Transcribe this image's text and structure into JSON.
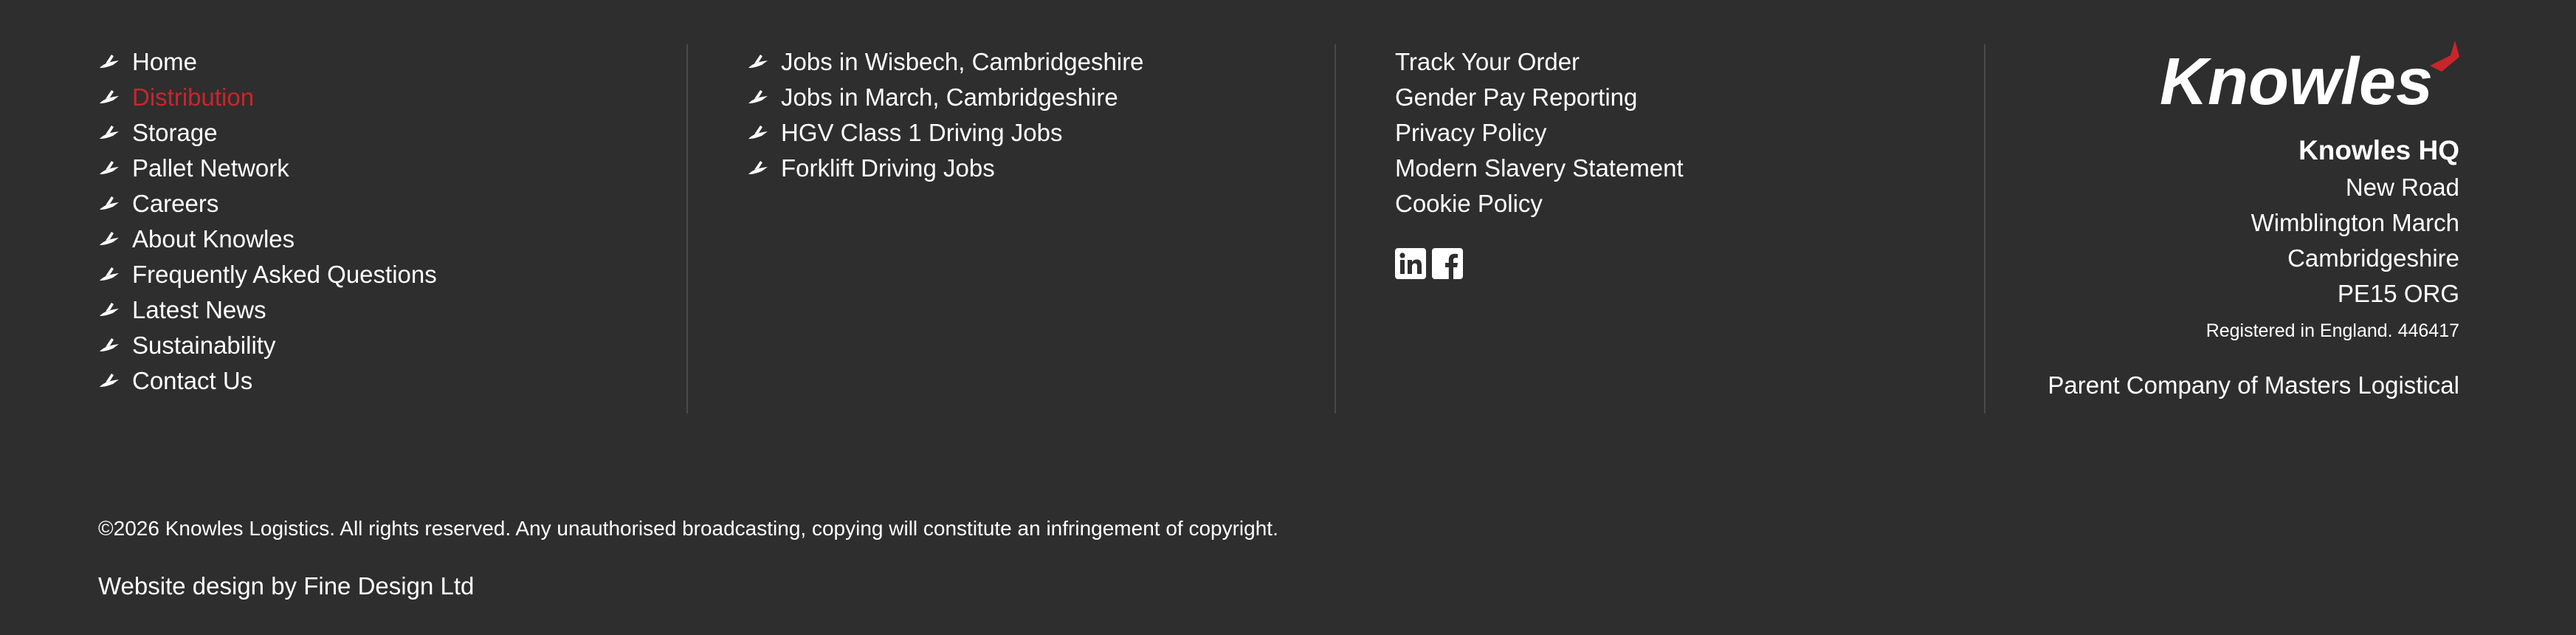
{
  "nav_primary": [
    {
      "label": "Home",
      "active": false
    },
    {
      "label": "Distribution",
      "active": true
    },
    {
      "label": "Storage",
      "active": false
    },
    {
      "label": "Pallet Network",
      "active": false
    },
    {
      "label": "Careers",
      "active": false
    },
    {
      "label": "About Knowles",
      "active": false
    },
    {
      "label": "Frequently Asked Questions",
      "active": false
    },
    {
      "label": "Latest News",
      "active": false
    },
    {
      "label": "Sustainability",
      "active": false
    },
    {
      "label": "Contact Us",
      "active": false
    }
  ],
  "nav_jobs": [
    {
      "label": "Jobs in Wisbech, Cambridgeshire"
    },
    {
      "label": "Jobs in March, Cambridgeshire"
    },
    {
      "label": "HGV Class 1 Driving Jobs"
    },
    {
      "label": "Forklift Driving Jobs"
    }
  ],
  "nav_info": [
    {
      "label": "Track Your Order"
    },
    {
      "label": "Gender Pay Reporting"
    },
    {
      "label": "Privacy Policy"
    },
    {
      "label": "Modern Slavery Statement"
    },
    {
      "label": "Cookie Policy"
    }
  ],
  "social": [
    {
      "icon": "linkedin-icon"
    },
    {
      "icon": "facebook-icon"
    }
  ],
  "brand": {
    "logo_text": "Knowles",
    "hq_title": "Knowles HQ",
    "address": [
      "New Road",
      "Wimblington March",
      "Cambridgeshire",
      "PE15 ORG"
    ],
    "registration": "Registered in England. 446417",
    "parent": "Parent Company of Masters Logistical"
  },
  "footer": {
    "copyright": "©2026 Knowles Logistics. All rights reserved. Any unauthorised broadcasting, copying will constitute an infringement of copyright.",
    "credit": "Website design by Fine Design Ltd"
  },
  "colors": {
    "background": "#2e2e2e",
    "text": "#ffffff",
    "accent": "#c8262c",
    "divider": "#4a4a4a"
  }
}
